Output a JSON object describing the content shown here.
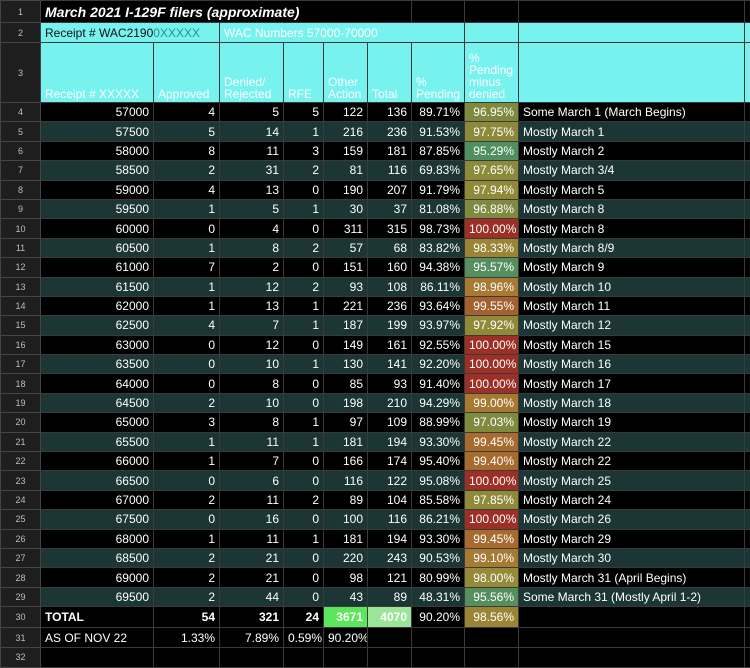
{
  "title": "March 2021 I-129F filers (approximate)",
  "row_numbers": [
    "1",
    "2",
    "3",
    "4",
    "5",
    "6",
    "7",
    "8",
    "9",
    "10",
    "11",
    "12",
    "13",
    "14",
    "15",
    "16",
    "17",
    "18",
    "19",
    "20",
    "21",
    "22",
    "23",
    "24",
    "25",
    "26",
    "27",
    "28",
    "29",
    "30",
    "31",
    "32"
  ],
  "subheader": {
    "receipt_prefix": "Receipt # WAC2190",
    "mask": "0XXXXX",
    "wac_numbers": "WAC Numbers 57000-70000"
  },
  "headers": {
    "receipt": "Receipt # XXXXX",
    "approved": "Approved",
    "denied": "Denied/ Rejected",
    "rfe": "RFE",
    "other": "Other Action",
    "total": "Total",
    "pct_pending": "% Pending",
    "pct_minus_denied": "% Pending minus denied"
  },
  "rows": [
    {
      "receipt": "57000",
      "approved": "4",
      "denied": "5",
      "rfe": "5",
      "other": "122",
      "total": "136",
      "pct": "89.71%",
      "pmd": "96.95%",
      "pmd_color": "#7f8a3f",
      "note": "Some March 1 (March Begins)"
    },
    {
      "receipt": "57500",
      "approved": "5",
      "denied": "14",
      "rfe": "1",
      "other": "216",
      "total": "236",
      "pct": "91.53%",
      "pmd": "97.75%",
      "pmd_color": "#8c8a3a",
      "note": "Mostly March 1"
    },
    {
      "receipt": "58000",
      "approved": "8",
      "denied": "11",
      "rfe": "3",
      "other": "159",
      "total": "181",
      "pct": "87.85%",
      "pmd": "95.29%",
      "pmd_color": "#508f60",
      "note": "Mostly March 2"
    },
    {
      "receipt": "58500",
      "approved": "2",
      "denied": "31",
      "rfe": "2",
      "other": "81",
      "total": "116",
      "pct": "69.83%",
      "pmd": "97.65%",
      "pmd_color": "#8a8a3a",
      "note": "Mostly March 3/4"
    },
    {
      "receipt": "59000",
      "approved": "4",
      "denied": "13",
      "rfe": "0",
      "other": "190",
      "total": "207",
      "pct": "91.79%",
      "pmd": "97.94%",
      "pmd_color": "#908a38",
      "note": "Mostly March 5"
    },
    {
      "receipt": "59500",
      "approved": "1",
      "denied": "5",
      "rfe": "1",
      "other": "30",
      "total": "37",
      "pct": "81.08%",
      "pmd": "96.88%",
      "pmd_color": "#7d8a40",
      "note": "Mostly March 8"
    },
    {
      "receipt": "60000",
      "approved": "0",
      "denied": "4",
      "rfe": "0",
      "other": "311",
      "total": "315",
      "pct": "98.73%",
      "pmd": "100.00%",
      "pmd_color": "#9c2f26",
      "note": "Mostly March 8"
    },
    {
      "receipt": "60500",
      "approved": "1",
      "denied": "8",
      "rfe": "2",
      "other": "57",
      "total": "68",
      "pct": "83.82%",
      "pmd": "98.33%",
      "pmd_color": "#9a8535",
      "note": "Mostly March 8/9"
    },
    {
      "receipt": "61000",
      "approved": "7",
      "denied": "2",
      "rfe": "0",
      "other": "151",
      "total": "160",
      "pct": "94.38%",
      "pmd": "95.57%",
      "pmd_color": "#558f5d",
      "note": "Mostly March 9"
    },
    {
      "receipt": "61500",
      "approved": "1",
      "denied": "12",
      "rfe": "2",
      "other": "93",
      "total": "108",
      "pct": "86.11%",
      "pmd": "98.96%",
      "pmd_color": "#a67a33",
      "note": "Mostly March 10"
    },
    {
      "receipt": "62000",
      "approved": "1",
      "denied": "13",
      "rfe": "1",
      "other": "221",
      "total": "236",
      "pct": "93.64%",
      "pmd": "99.55%",
      "pmd_color": "#a5612d",
      "note": "Mostly March 11"
    },
    {
      "receipt": "62500",
      "approved": "4",
      "denied": "7",
      "rfe": "1",
      "other": "187",
      "total": "199",
      "pct": "93.97%",
      "pmd": "97.92%",
      "pmd_color": "#908a38",
      "note": "Mostly March 12"
    },
    {
      "receipt": "63000",
      "approved": "0",
      "denied": "12",
      "rfe": "0",
      "other": "149",
      "total": "161",
      "pct": "92.55%",
      "pmd": "100.00%",
      "pmd_color": "#9c2f26",
      "note": "Mostly March 15"
    },
    {
      "receipt": "63500",
      "approved": "0",
      "denied": "10",
      "rfe": "1",
      "other": "130",
      "total": "141",
      "pct": "92.20%",
      "pmd": "100.00%",
      "pmd_color": "#9c2f26",
      "note": "Mostly March 16"
    },
    {
      "receipt": "64000",
      "approved": "0",
      "denied": "8",
      "rfe": "0",
      "other": "85",
      "total": "93",
      "pct": "91.40%",
      "pmd": "100.00%",
      "pmd_color": "#9c2f26",
      "note": "Mostly March 17"
    },
    {
      "receipt": "64500",
      "approved": "2",
      "denied": "10",
      "rfe": "0",
      "other": "198",
      "total": "210",
      "pct": "94.29%",
      "pmd": "99.00%",
      "pmd_color": "#a67a33",
      "note": "Mostly March 18"
    },
    {
      "receipt": "65000",
      "approved": "3",
      "denied": "8",
      "rfe": "1",
      "other": "97",
      "total": "109",
      "pct": "88.99%",
      "pmd": "97.03%",
      "pmd_color": "#7f8a3f",
      "note": "Mostly March 19"
    },
    {
      "receipt": "65500",
      "approved": "1",
      "denied": "11",
      "rfe": "1",
      "other": "181",
      "total": "194",
      "pct": "93.30%",
      "pmd": "99.45%",
      "pmd_color": "#a76b2f",
      "note": "Mostly March 22"
    },
    {
      "receipt": "66000",
      "approved": "1",
      "denied": "7",
      "rfe": "0",
      "other": "166",
      "total": "174",
      "pct": "95.40%",
      "pmd": "99.40%",
      "pmd_color": "#a76b2f",
      "note": "Mostly March 22"
    },
    {
      "receipt": "66500",
      "approved": "0",
      "denied": "6",
      "rfe": "0",
      "other": "116",
      "total": "122",
      "pct": "95.08%",
      "pmd": "100.00%",
      "pmd_color": "#9c2f26",
      "note": "Mostly March 25"
    },
    {
      "receipt": "67000",
      "approved": "2",
      "denied": "11",
      "rfe": "2",
      "other": "89",
      "total": "104",
      "pct": "85.58%",
      "pmd": "97.85%",
      "pmd_color": "#8e8a39",
      "note": "Mostly March 24"
    },
    {
      "receipt": "67500",
      "approved": "0",
      "denied": "16",
      "rfe": "0",
      "other": "100",
      "total": "116",
      "pct": "86.21%",
      "pmd": "100.00%",
      "pmd_color": "#9c2f26",
      "note": "Mostly March 26"
    },
    {
      "receipt": "68000",
      "approved": "1",
      "denied": "11",
      "rfe": "1",
      "other": "181",
      "total": "194",
      "pct": "93.30%",
      "pmd": "99.45%",
      "pmd_color": "#a76b2f",
      "note": "Mostly March 29"
    },
    {
      "receipt": "68500",
      "approved": "2",
      "denied": "21",
      "rfe": "0",
      "other": "220",
      "total": "243",
      "pct": "90.53%",
      "pmd": "99.10%",
      "pmd_color": "#a67a33",
      "note": "Mostly March 30"
    },
    {
      "receipt": "69000",
      "approved": "2",
      "denied": "21",
      "rfe": "0",
      "other": "98",
      "total": "121",
      "pct": "80.99%",
      "pmd": "98.00%",
      "pmd_color": "#948a37",
      "note": "Mostly March 31 (April Begins)"
    },
    {
      "receipt": "69500",
      "approved": "2",
      "denied": "44",
      "rfe": "0",
      "other": "43",
      "total": "89",
      "pct": "48.31%",
      "pmd": "95.56%",
      "pmd_color": "#558f5d",
      "note": "Some March 31 (Mostly April 1-2)"
    }
  ],
  "totals": {
    "label": "TOTAL",
    "approved": "54",
    "denied": "321",
    "rfe": "24",
    "other": "3671",
    "total": "4070",
    "pct": "90.20%",
    "pmd": "98.56%",
    "pmd_color": "#9c8435"
  },
  "as_of": {
    "label": "AS OF NOV 22",
    "approved": "1.33%",
    "denied": "7.89%",
    "rfe": "0.59%",
    "other": "90.20%"
  }
}
